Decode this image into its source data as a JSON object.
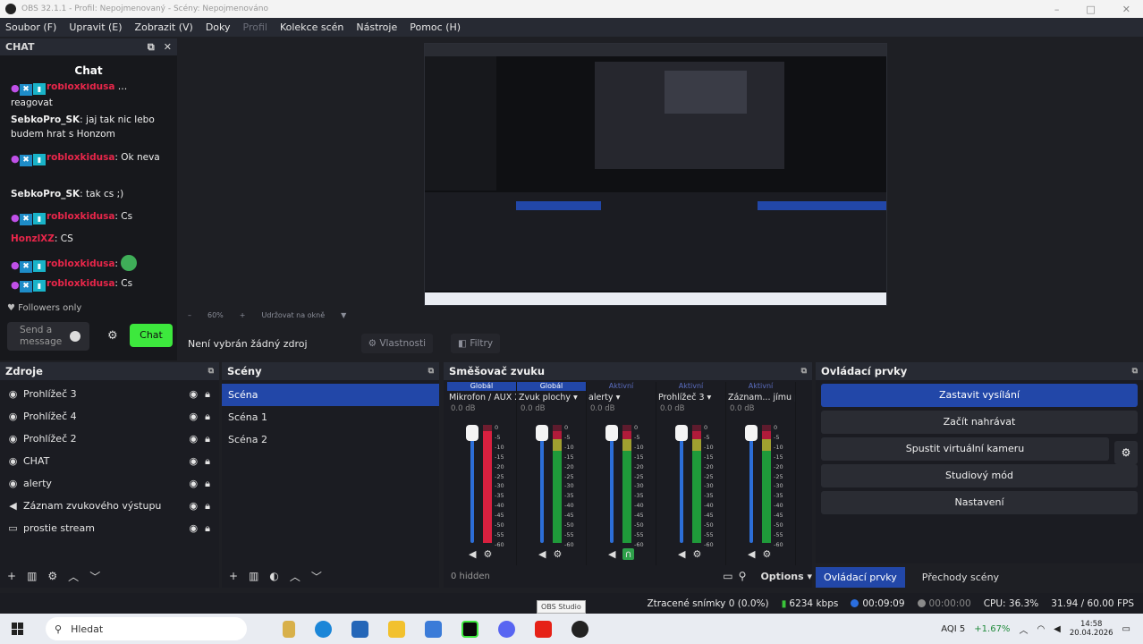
{
  "window": {
    "title": "OBS 32.1.1 - Profil: Nepojmenovaný - Scény: Nepojmenováno",
    "controls": [
      "–",
      "□",
      "✕"
    ]
  },
  "menu": {
    "items": [
      "Soubor (F)",
      "Upravit (E)",
      "Zobrazit (V)",
      "Doky",
      "Profil",
      "Kolekce scén",
      "Nástroje",
      "Pomoc (H)"
    ]
  },
  "chat": {
    "dock_label": "CHAT",
    "title": "Chat",
    "messages": [
      {
        "text": "reagovat"
      },
      {
        "user": "SebkoPro_SK",
        "text": ": jaj tak nic lebo budem hrat s Honzom"
      },
      {
        "user": "robloxkidusa",
        "text": ": Ok neva"
      },
      {
        "user": "SebkoPro_SK",
        "text": ": tak cs ;)"
      },
      {
        "user": "robloxkidusa",
        "text": ": Cs"
      },
      {
        "user": "HonzlXZ",
        "text": ": CS"
      },
      {
        "user": "robloxkidusa",
        "text": ": "
      },
      {
        "user": "robloxkidusa",
        "text": ": Cs"
      }
    ],
    "followers_only": "Followers only",
    "input_placeholder": "Send a message",
    "send_button": "Chat",
    "colors": {
      "send": "#3de83d",
      "name_red": "#e8264a"
    }
  },
  "preview": {
    "zoom": "60%",
    "scale_label": "Udržovat na okně",
    "no_source": "Není vybrán žádný zdroj",
    "properties": "Vlastnosti",
    "filters": "Filtry"
  },
  "sources": {
    "title": "Zdroje",
    "items": [
      {
        "label": "Prohlížeč 3",
        "icon": "globe-icon"
      },
      {
        "label": "Prohlížeč 4",
        "icon": "globe-icon"
      },
      {
        "label": "Prohlížeč 2",
        "icon": "globe-icon"
      },
      {
        "label": "CHAT",
        "icon": "globe-icon"
      },
      {
        "label": "alerty",
        "icon": "globe-icon"
      },
      {
        "label": "Záznam zvukového výstupu",
        "icon": "speaker-icon"
      },
      {
        "label": "prostie stream",
        "icon": "monitor-icon"
      }
    ]
  },
  "scenes": {
    "title": "Scény",
    "items": [
      "Scéna",
      "Scéna 1",
      "Scéna 2"
    ],
    "selected": 0
  },
  "mixer": {
    "title": "Směšovač zvuku",
    "channels": [
      {
        "tab": "Globál",
        "name": "Mikrofon / AUX 2",
        "db": "0.0 dB",
        "level": 0.95,
        "red": true,
        "fader": 1.0
      },
      {
        "tab": "Globál",
        "name": "Zvuk plochy",
        "db": "0.0 dB",
        "level": 0.95,
        "red": false,
        "fader": 1.0
      },
      {
        "tab": "Aktivní",
        "name": "alerty",
        "db": "0.0 dB",
        "level": 0.95,
        "red": false,
        "fader": 1.0
      },
      {
        "tab": "Aktivní",
        "name": "Prohlížeč 3",
        "db": "0.0 dB",
        "level": 0.95,
        "red": false,
        "fader": 1.0
      },
      {
        "tab": "Aktivní",
        "name": "Záznam... jímu pu",
        "db": "0.0 dB",
        "level": 0.95,
        "red": false,
        "fader": 1.0
      }
    ],
    "scale": [
      "0",
      "-5",
      "-10",
      "-15",
      "-20",
      "-25",
      "-30",
      "-35",
      "-40",
      "-45",
      "-50",
      "-55",
      "-60"
    ],
    "hidden": "0 hidden",
    "options": "Options"
  },
  "controls": {
    "title": "Ovládací prvky",
    "buttons": [
      "Zastavit vysílání",
      "Začít nahrávat",
      "Spustit virtuální kameru",
      "Studiový mód",
      "Nastavení"
    ],
    "tabs": [
      "Ovládací prvky",
      "Přechody scény"
    ]
  },
  "status": {
    "dropped": "Ztracené snímky 0 (0.0%)",
    "bitrate": "6234 kbps",
    "live_time": "00:09:09",
    "rec_time": "00:00:00",
    "cpu": "CPU: 36.3%",
    "fps": "31.94 / 60.00 FPS",
    "tooltip": "OBS Studio"
  },
  "taskbar": {
    "search": "Hledat",
    "weather": "AQI 5",
    "percent": "+1.67%",
    "time": "14:58",
    "date": "20.04.2026"
  }
}
